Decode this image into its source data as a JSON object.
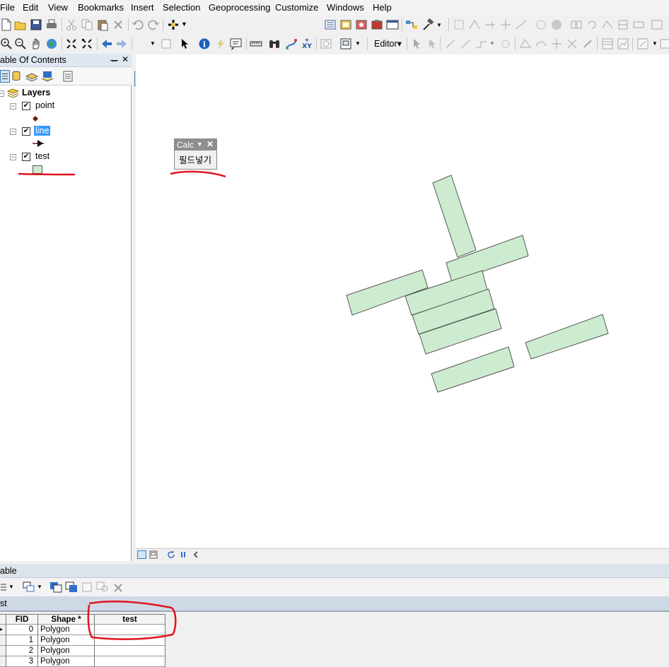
{
  "menu": [
    "File",
    "Edit",
    "View",
    "Bookmarks",
    "Insert",
    "Selection",
    "Geoprocessing",
    "Customize",
    "Windows",
    "Help"
  ],
  "editor_toolbar": {
    "label": "Editor▾"
  },
  "toc": {
    "title": "able Of Contents",
    "pin": "ᅲ",
    "close": "✕",
    "root_label": "Layers",
    "layers": [
      {
        "name": "point",
        "checked": true,
        "selected": false,
        "symbol": "point"
      },
      {
        "name": "line",
        "checked": true,
        "selected": true,
        "symbol": "line"
      },
      {
        "name": "test",
        "checked": true,
        "selected": false,
        "symbol": "polygon"
      }
    ],
    "check_mark": "✔"
  },
  "calc_toolbar": {
    "title": "Calc",
    "close": "✕",
    "button_label": "필드넣기"
  },
  "map": {
    "polygon_fill": "#cdeccf",
    "polygon_stroke": "#555555"
  },
  "table_window": {
    "title": "able",
    "tab_label": "st",
    "columns": [
      "FID",
      "Shape *",
      "test"
    ],
    "rows": [
      {
        "fid": "0",
        "shape": "Polygon",
        "test": ""
      },
      {
        "fid": "1",
        "shape": "Polygon",
        "test": ""
      },
      {
        "fid": "2",
        "shape": "Polygon",
        "test": ""
      },
      {
        "fid": "3",
        "shape": "Polygon",
        "test": ""
      }
    ]
  },
  "colors": {
    "annotation_red": "#e0141e",
    "selected_blue": "#3399ff"
  }
}
